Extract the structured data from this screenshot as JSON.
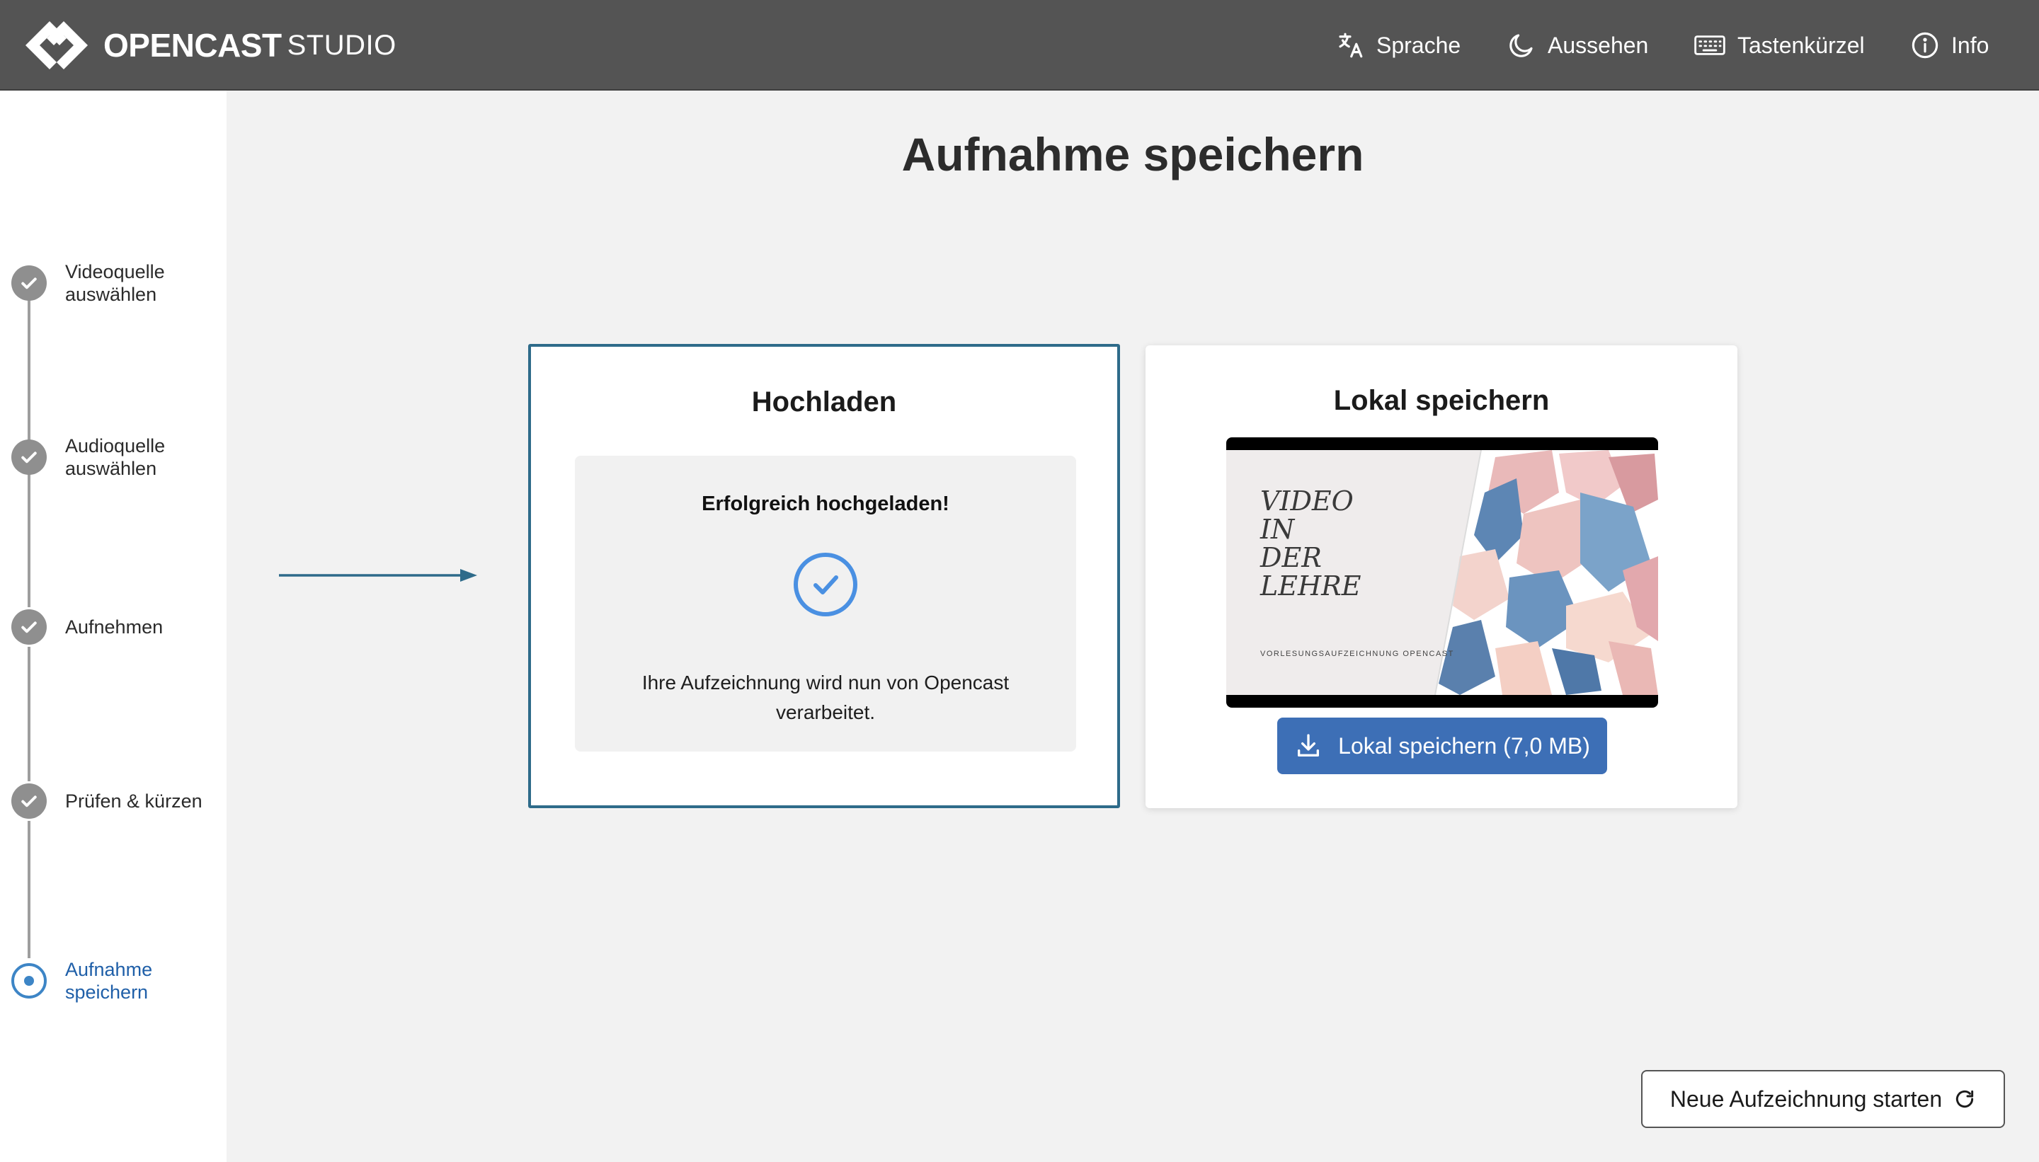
{
  "app": {
    "logo_main": "OPENCAST",
    "logo_sub": "STUDIO"
  },
  "header": {
    "nav": [
      {
        "label": "Sprache",
        "icon": "translate-icon"
      },
      {
        "label": "Aussehen",
        "icon": "moon-icon"
      },
      {
        "label": "Tastenkürzel",
        "icon": "keyboard-icon"
      },
      {
        "label": "Info",
        "icon": "info-icon"
      }
    ]
  },
  "sidebar": {
    "steps": [
      {
        "label": "Videoquelle auswählen",
        "state": "done"
      },
      {
        "label": "Audioquelle auswählen",
        "state": "done"
      },
      {
        "label": "Aufnehmen",
        "state": "done"
      },
      {
        "label": "Prüfen & kürzen",
        "state": "done"
      },
      {
        "label": "Aufnahme speichern",
        "state": "active"
      }
    ]
  },
  "main": {
    "title": "Aufnahme speichern",
    "upload": {
      "heading": "Hochladen",
      "status_title": "Erfolgreich hochgeladen!",
      "status_text": "Ihre Aufzeichnung wird nun von Opencast verarbeitet."
    },
    "local": {
      "heading": "Lokal speichern",
      "preview_lines": [
        "VIDEO",
        "IN",
        "DER",
        "LEHRE"
      ],
      "preview_caption": "VORLESUNGSAUFZEICHNUNG OPENCAST",
      "download_label": "Lokal speichern (7,0 MB)"
    },
    "new_recording_label": "Neue Aufzeichnung starten"
  },
  "colors": {
    "header_bg": "#545454",
    "accent_blue": "#3d6fb6",
    "active_step": "#3d85c6",
    "upload_border": "#2e6b8a"
  }
}
